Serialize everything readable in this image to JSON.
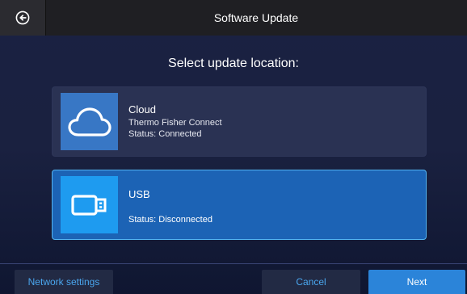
{
  "header": {
    "title": "Software Update",
    "back_icon": "arrow-left-circle-icon"
  },
  "prompt": "Select update location:",
  "options": [
    {
      "icon": "cloud-icon",
      "title": "Cloud",
      "line1": "Thermo Fisher Connect",
      "status": "Status: Connected",
      "selected": false
    },
    {
      "icon": "usb-drive-icon",
      "title": "USB",
      "line1": "",
      "status": "Status: Disconnected",
      "selected": true
    }
  ],
  "footer": {
    "network_label": "Network settings",
    "cancel_label": "Cancel",
    "next_label": "Next"
  },
  "colors": {
    "accent": "#1e9bf0",
    "selected_card": "#1c63b5",
    "link_text": "#4aa6ee",
    "primary_button": "#2b84d9"
  }
}
